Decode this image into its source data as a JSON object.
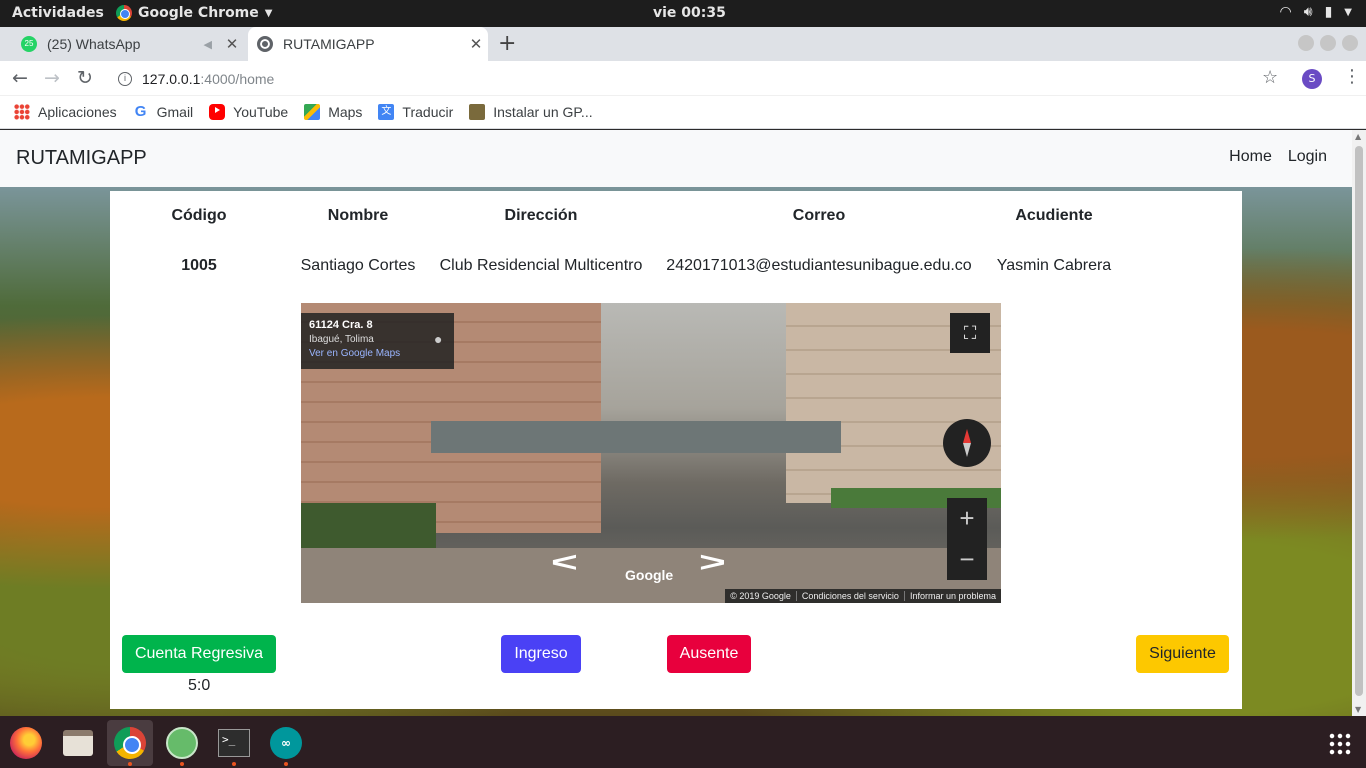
{
  "system_bar": {
    "activities": "Actividades",
    "app_menu": "Google Chrome",
    "clock": "vie 00:35"
  },
  "tabs": [
    {
      "title": "(25) WhatsApp",
      "badge": "25",
      "icon": "whatsapp-icon"
    },
    {
      "title": "RUTAMIGAPP",
      "icon": "globe-icon"
    }
  ],
  "address_bar": {
    "host": "127.0.0.1",
    "path": ":4000/home",
    "profile_initial": "S"
  },
  "bookmarks": [
    {
      "label": "Aplicaciones",
      "icon": "apps-grid-icon"
    },
    {
      "label": "Gmail",
      "icon": "google-icon"
    },
    {
      "label": "YouTube",
      "icon": "youtube-icon"
    },
    {
      "label": "Maps",
      "icon": "maps-icon"
    },
    {
      "label": "Traducir",
      "icon": "translate-icon"
    },
    {
      "label": "Instalar un GP...",
      "icon": "bookmark-page-icon"
    }
  ],
  "navbar": {
    "brand": "RUTAMIGAPP",
    "links": [
      "Home",
      "Login"
    ]
  },
  "table": {
    "headers": [
      "Código",
      "Nombre",
      "Dirección",
      "Correo",
      "Acudiente"
    ],
    "row": [
      "1005",
      "Santiago Cortes",
      "Club Residencial Multicentro",
      "2420171013@estudiantesunibague.edu.co",
      "Yasmin Cabrera"
    ]
  },
  "street_view": {
    "address_line": "61124 Cra. 8",
    "city": "Ibagué, Tolima",
    "maps_link": "Ver en Google Maps",
    "logo": "Google",
    "footer": [
      "© 2019 Google",
      "Condiciones del servicio",
      "Informar un problema"
    ],
    "zoom_in": "+",
    "zoom_out": "−"
  },
  "actions": {
    "countdown": "Cuenta Regresiva",
    "timer": "5:0",
    "check_in": "Ingreso",
    "absent": "Ausente",
    "next": "Siguiente"
  },
  "colors": {
    "countdown_button": "#00b44c",
    "check_in_button": "#4a41f5",
    "absent_button": "#e8003d",
    "next_button": "#fdc800"
  },
  "dock": [
    "firefox-icon",
    "files-icon",
    "chrome-icon",
    "atom-icon",
    "terminal-icon",
    "arduino-icon",
    "show-apps-icon"
  ]
}
